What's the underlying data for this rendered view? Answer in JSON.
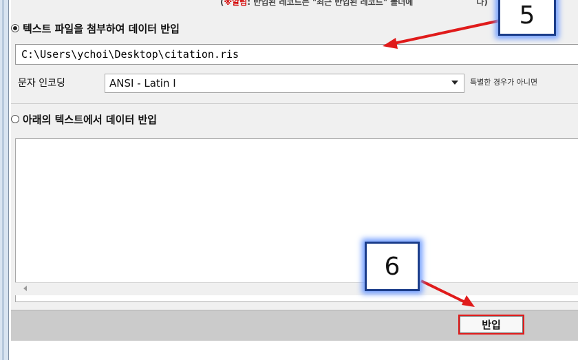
{
  "notice": {
    "prefix": "(",
    "warning_label": "※알림",
    "text": ": 반입된 레코드는 \"최근 반입된 레코드\" 폴더에",
    "suffix": "다)"
  },
  "file_option": {
    "label": "텍스트 파일을 첨부하여 데이터 반입",
    "checked": true,
    "path_value": "C:\\Users\\ychoi\\Desktop\\citation.ris",
    "encoding_label": "문자 인코딩",
    "encoding_value": "ANSI - Latin I",
    "encoding_hint": "특별한 경우가 아니면"
  },
  "text_option": {
    "label": "아래의 텍스트에서 데이터 반입",
    "checked": false,
    "text_value": ""
  },
  "toolbar": {
    "import_label": "반입"
  },
  "callouts": {
    "step5": "5",
    "step6": "6"
  },
  "colors": {
    "callout_border": "#1b3d8a",
    "callout_glow": "#6f9cff",
    "arrow": "#e01b1b"
  }
}
